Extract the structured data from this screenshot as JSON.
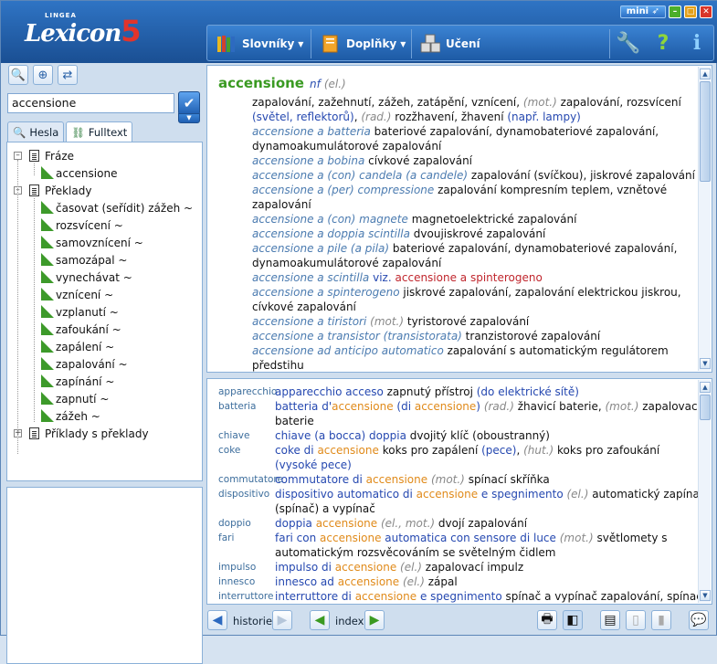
{
  "app": {
    "logo_small": "LINGEA",
    "logo_main": "Lexicon",
    "logo_num": "5",
    "mini_label": "mini"
  },
  "toolbar": {
    "dictionaries": "Slovníky",
    "addons": "Doplňky",
    "learning": "Učení"
  },
  "search": {
    "value": "accensione"
  },
  "tabs": {
    "hesla": "Hesla",
    "fulltext": "Fulltext"
  },
  "tree": {
    "fraze": "Fráze",
    "fraze_child": "accensione",
    "preklady": "Překlady",
    "preklady_items": [
      "časovat (seřídit) zážeh ~",
      "rozsvícení ~",
      "samovznícení ~",
      "samozápal ~",
      "vynechávat ~",
      "vznícení ~",
      "vzplanutí ~",
      "zafoukání ~",
      "zapálení ~",
      "zapalování ~",
      "zapínání ~",
      "zapnutí ~",
      "zážeh ~"
    ],
    "priklady": "Příklady s překlady"
  },
  "entry": {
    "headword": "accensione",
    "pos": "nf",
    "gram": "(el.)",
    "lines": [
      [
        [
          "t",
          "zapalování, zažehnutí, zážeh, zatápění, vznícení, "
        ],
        [
          "g",
          "(mot.)"
        ],
        [
          "t",
          " zapalování, rozsvícení"
        ]
      ],
      [
        [
          "b",
          "(světel, reflektorů)"
        ],
        [
          "t",
          ", "
        ],
        [
          "g",
          "(rad.)"
        ],
        [
          "t",
          " rozžhavení, žhavení "
        ],
        [
          "b",
          "(např. lampy)"
        ]
      ],
      [
        [
          "i",
          "accensione a batteria"
        ],
        [
          "t",
          "  bateriové zapalování, dynamobateriové zapalování,"
        ]
      ],
      [
        [
          "t",
          "dynamoakumulátorové zapalování"
        ]
      ],
      [
        [
          "i",
          "accensione a bobina"
        ],
        [
          "t",
          "  cívkové zapalování"
        ]
      ],
      [
        [
          "i",
          "accensione a (con) candela (a candele)"
        ],
        [
          "t",
          "  zapalování (svíčkou), jiskrové zapalování"
        ]
      ],
      [
        [
          "i",
          "accensione a (per) compressione"
        ],
        [
          "t",
          "  zapalování kompresním teplem, vznětové"
        ]
      ],
      [
        [
          "t",
          "zapalování"
        ]
      ],
      [
        [
          "i",
          "accensione a (con) magnete"
        ],
        [
          "t",
          "  magnetoelektrické zapalování"
        ]
      ],
      [
        [
          "i",
          "accensione a doppia scintilla"
        ],
        [
          "t",
          "  dvoujiskrové zapalování"
        ]
      ],
      [
        [
          "i",
          "accensione a pile (a pila)"
        ],
        [
          "t",
          "  bateriové zapalování, dynamobateriové zapalování,"
        ]
      ],
      [
        [
          "t",
          "dynamoakumulátorové zapalování"
        ]
      ],
      [
        [
          "i",
          "accensione a scintilla"
        ],
        [
          "t",
          "  "
        ],
        [
          "b",
          "viz."
        ],
        [
          "t",
          " "
        ],
        [
          "r",
          "accensione a spinterogeno"
        ]
      ],
      [
        [
          "i",
          "accensione a spinterogeno"
        ],
        [
          "t",
          "  jiskrové zapalování, zapalování elektrickou jiskrou,"
        ]
      ],
      [
        [
          "t",
          "cívkové zapalování"
        ]
      ],
      [
        [
          "i",
          "accensione a tiristori"
        ],
        [
          "t",
          "  "
        ],
        [
          "g",
          "(mot.)"
        ],
        [
          "t",
          " tyristorové zapalování"
        ]
      ],
      [
        [
          "i",
          "accensione a transistor (transistorata)"
        ],
        [
          "t",
          "  tranzistorové zapalování"
        ]
      ],
      [
        [
          "i",
          "accensione ad anticipo automatico"
        ],
        [
          "t",
          "  zapalování s automatickým regulátorem"
        ]
      ],
      [
        [
          "t",
          "předstihu"
        ]
      ]
    ]
  },
  "examples": [
    {
      "kw": "apparecchio",
      "line": [
        [
          "b",
          "apparecchio acceso"
        ],
        [
          "t",
          "  zapnutý přístroj "
        ],
        [
          "b",
          "(do elektrické sítě)"
        ]
      ]
    },
    {
      "kw": "batteria",
      "line": [
        [
          "b",
          "batteria d'"
        ],
        [
          "o",
          "accensione"
        ],
        [
          "b",
          " (di "
        ],
        [
          "o",
          "accensione"
        ],
        [
          "b",
          ")"
        ],
        [
          "t",
          "  "
        ],
        [
          "g",
          "(rad.)"
        ],
        [
          "t",
          " žhavicí baterie, "
        ],
        [
          "g",
          "(mot.)"
        ],
        [
          "t",
          " zapalovací"
        ]
      ]
    },
    {
      "kw": "",
      "line": [
        [
          "t",
          "baterie"
        ]
      ]
    },
    {
      "kw": "chiave",
      "line": [
        [
          "b",
          "chiave (a bocca) doppia"
        ],
        [
          "t",
          "  dvojitý klíč (oboustranný)"
        ]
      ]
    },
    {
      "kw": "coke",
      "line": [
        [
          "b",
          "coke di "
        ],
        [
          "o",
          "accensione"
        ],
        [
          "t",
          "  koks pro zapálení "
        ],
        [
          "b",
          "(pece)"
        ],
        [
          "t",
          ", "
        ],
        [
          "g",
          "(hut.)"
        ],
        [
          "t",
          " koks pro zafoukání"
        ]
      ]
    },
    {
      "kw": "",
      "line": [
        [
          "b",
          "(vysoké pece)"
        ]
      ]
    },
    {
      "kw": "commutatore",
      "line": [
        [
          "b",
          "commutatore di "
        ],
        [
          "o",
          "accensione"
        ],
        [
          "t",
          "  "
        ],
        [
          "g",
          "(mot.)"
        ],
        [
          "t",
          " spínací skříňka"
        ]
      ]
    },
    {
      "kw": "dispositivo",
      "line": [
        [
          "b",
          "dispositivo automatico di "
        ],
        [
          "o",
          "accensione"
        ],
        [
          "b",
          " e spegnimento"
        ],
        [
          "t",
          "  "
        ],
        [
          "g",
          "(el.)"
        ],
        [
          "t",
          " automatický zapínač"
        ]
      ]
    },
    {
      "kw": "",
      "line": [
        [
          "t",
          "(spínač) a vypínač"
        ]
      ]
    },
    {
      "kw": "doppio",
      "line": [
        [
          "b",
          "doppia "
        ],
        [
          "o",
          "accensione"
        ],
        [
          "t",
          "  "
        ],
        [
          "g",
          "(el., mot.)"
        ],
        [
          "t",
          " dvojí zapalování"
        ]
      ]
    },
    {
      "kw": "fari",
      "line": [
        [
          "b",
          "fari con "
        ],
        [
          "o",
          "accensione"
        ],
        [
          "b",
          " automatica con sensore di luce"
        ],
        [
          "t",
          "  "
        ],
        [
          "g",
          "(mot.)"
        ],
        [
          "t",
          " světlomety s"
        ]
      ]
    },
    {
      "kw": "",
      "line": [
        [
          "t",
          "automatickým rozsvěcováním se světelným čidlem"
        ]
      ]
    },
    {
      "kw": "impulso",
      "line": [
        [
          "b",
          "impulso di "
        ],
        [
          "o",
          "accensione"
        ],
        [
          "t",
          "  "
        ],
        [
          "g",
          "(el.)"
        ],
        [
          "t",
          " zapalovací impulz"
        ]
      ]
    },
    {
      "kw": "innesco",
      "line": [
        [
          "b",
          "innesco ad "
        ],
        [
          "o",
          "accensione"
        ],
        [
          "t",
          "  "
        ],
        [
          "g",
          "(el.)"
        ],
        [
          "t",
          " zápal"
        ]
      ]
    },
    {
      "kw": "interruttore",
      "line": [
        [
          "b",
          "interruttore di "
        ],
        [
          "o",
          "accensione"
        ],
        [
          "b",
          " e spegnimento"
        ],
        [
          "t",
          "  spínač a vypínač zapalování, spínací"
        ]
      ]
    }
  ],
  "nav": {
    "history": "historie",
    "index": "index"
  },
  "colors": {
    "headword": "#3a9a22",
    "accent_blue": "#2548b0",
    "highlight_orange": "#e08a1a",
    "link_red": "#c0262d"
  }
}
